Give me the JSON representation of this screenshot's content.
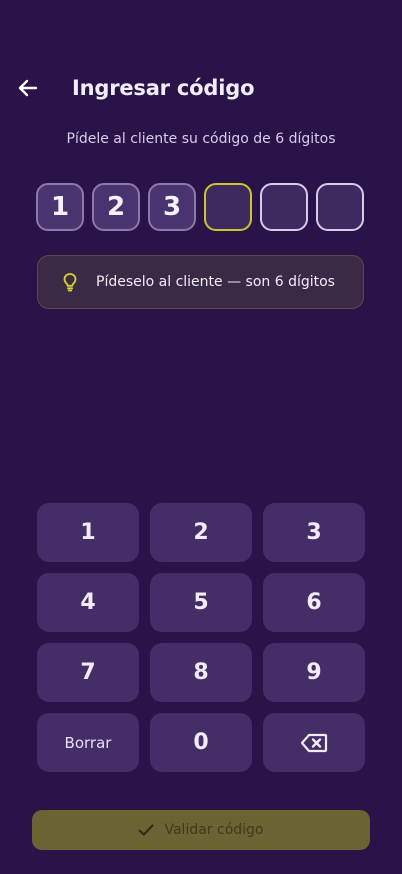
{
  "header": {
    "title": "Ingresar código",
    "back_icon": "arrow-left-icon"
  },
  "subtitle": "Pídele al cliente su código de 6 dígitos",
  "code": {
    "digits": [
      "1",
      "2",
      "3",
      "",
      "",
      ""
    ],
    "active_index": 3
  },
  "hint": {
    "icon": "lightbulb-icon",
    "text": "Pídeselo al cliente — son 6 dígitos",
    "icon_color": "#d8d22a"
  },
  "keypad": {
    "k1": "1",
    "k2": "2",
    "k3": "3",
    "k4": "4",
    "k5": "5",
    "k6": "6",
    "k7": "7",
    "k8": "8",
    "k9": "9",
    "clear": "Borrar",
    "k0": "0",
    "backspace_icon": "backspace-icon"
  },
  "submit": {
    "label": "Validar código",
    "icon": "check-icon"
  },
  "colors": {
    "background": "#2a1349",
    "key": "#452d67",
    "accent": "#c9c72a",
    "submit_disabled": "#6b6331"
  }
}
